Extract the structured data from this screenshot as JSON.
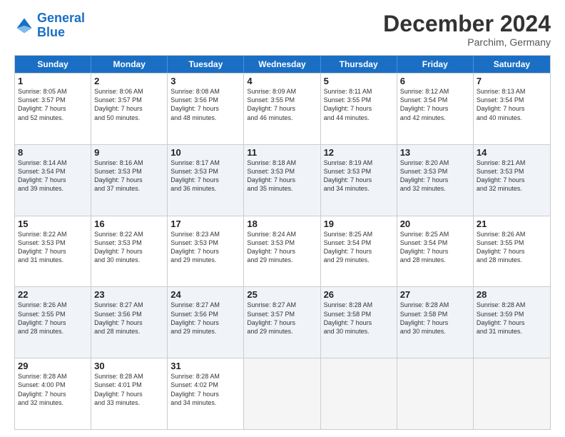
{
  "header": {
    "logo_line1": "General",
    "logo_line2": "Blue",
    "title": "December 2024",
    "subtitle": "Parchim, Germany"
  },
  "calendar": {
    "days_of_week": [
      "Sunday",
      "Monday",
      "Tuesday",
      "Wednesday",
      "Thursday",
      "Friday",
      "Saturday"
    ],
    "weeks": [
      [
        {
          "day": "",
          "empty": true
        },
        {
          "day": "",
          "empty": true
        },
        {
          "day": "",
          "empty": true
        },
        {
          "day": "",
          "empty": true
        },
        {
          "day": "",
          "empty": true
        },
        {
          "day": "",
          "empty": true
        },
        {
          "day": "",
          "empty": true
        }
      ],
      [
        {
          "day": "1",
          "sunrise": "8:05 AM",
          "sunset": "3:57 PM",
          "daylight": "7 hours and 52 minutes."
        },
        {
          "day": "2",
          "sunrise": "8:06 AM",
          "sunset": "3:57 PM",
          "daylight": "7 hours and 50 minutes."
        },
        {
          "day": "3",
          "sunrise": "8:08 AM",
          "sunset": "3:56 PM",
          "daylight": "7 hours and 48 minutes."
        },
        {
          "day": "4",
          "sunrise": "8:09 AM",
          "sunset": "3:55 PM",
          "daylight": "7 hours and 46 minutes."
        },
        {
          "day": "5",
          "sunrise": "8:11 AM",
          "sunset": "3:55 PM",
          "daylight": "7 hours and 44 minutes."
        },
        {
          "day": "6",
          "sunrise": "8:12 AM",
          "sunset": "3:54 PM",
          "daylight": "7 hours and 42 minutes."
        },
        {
          "day": "7",
          "sunrise": "8:13 AM",
          "sunset": "3:54 PM",
          "daylight": "7 hours and 40 minutes."
        }
      ],
      [
        {
          "day": "8",
          "sunrise": "8:14 AM",
          "sunset": "3:54 PM",
          "daylight": "7 hours and 39 minutes."
        },
        {
          "day": "9",
          "sunrise": "8:16 AM",
          "sunset": "3:53 PM",
          "daylight": "7 hours and 37 minutes."
        },
        {
          "day": "10",
          "sunrise": "8:17 AM",
          "sunset": "3:53 PM",
          "daylight": "7 hours and 36 minutes."
        },
        {
          "day": "11",
          "sunrise": "8:18 AM",
          "sunset": "3:53 PM",
          "daylight": "7 hours and 35 minutes."
        },
        {
          "day": "12",
          "sunrise": "8:19 AM",
          "sunset": "3:53 PM",
          "daylight": "7 hours and 34 minutes."
        },
        {
          "day": "13",
          "sunrise": "8:20 AM",
          "sunset": "3:53 PM",
          "daylight": "7 hours and 32 minutes."
        },
        {
          "day": "14",
          "sunrise": "8:21 AM",
          "sunset": "3:53 PM",
          "daylight": "7 hours and 32 minutes."
        }
      ],
      [
        {
          "day": "15",
          "sunrise": "8:22 AM",
          "sunset": "3:53 PM",
          "daylight": "7 hours and 31 minutes."
        },
        {
          "day": "16",
          "sunrise": "8:22 AM",
          "sunset": "3:53 PM",
          "daylight": "7 hours and 30 minutes."
        },
        {
          "day": "17",
          "sunrise": "8:23 AM",
          "sunset": "3:53 PM",
          "daylight": "7 hours and 29 minutes."
        },
        {
          "day": "18",
          "sunrise": "8:24 AM",
          "sunset": "3:53 PM",
          "daylight": "7 hours and 29 minutes."
        },
        {
          "day": "19",
          "sunrise": "8:25 AM",
          "sunset": "3:54 PM",
          "daylight": "7 hours and 29 minutes."
        },
        {
          "day": "20",
          "sunrise": "8:25 AM",
          "sunset": "3:54 PM",
          "daylight": "7 hours and 28 minutes."
        },
        {
          "day": "21",
          "sunrise": "8:26 AM",
          "sunset": "3:55 PM",
          "daylight": "7 hours and 28 minutes."
        }
      ],
      [
        {
          "day": "22",
          "sunrise": "8:26 AM",
          "sunset": "3:55 PM",
          "daylight": "7 hours and 28 minutes."
        },
        {
          "day": "23",
          "sunrise": "8:27 AM",
          "sunset": "3:56 PM",
          "daylight": "7 hours and 28 minutes."
        },
        {
          "day": "24",
          "sunrise": "8:27 AM",
          "sunset": "3:56 PM",
          "daylight": "7 hours and 29 minutes."
        },
        {
          "day": "25",
          "sunrise": "8:27 AM",
          "sunset": "3:57 PM",
          "daylight": "7 hours and 29 minutes."
        },
        {
          "day": "26",
          "sunrise": "8:28 AM",
          "sunset": "3:58 PM",
          "daylight": "7 hours and 30 minutes."
        },
        {
          "day": "27",
          "sunrise": "8:28 AM",
          "sunset": "3:58 PM",
          "daylight": "7 hours and 30 minutes."
        },
        {
          "day": "28",
          "sunrise": "8:28 AM",
          "sunset": "3:59 PM",
          "daylight": "7 hours and 31 minutes."
        }
      ],
      [
        {
          "day": "29",
          "sunrise": "8:28 AM",
          "sunset": "4:00 PM",
          "daylight": "7 hours and 32 minutes."
        },
        {
          "day": "30",
          "sunrise": "8:28 AM",
          "sunset": "4:01 PM",
          "daylight": "7 hours and 33 minutes."
        },
        {
          "day": "31",
          "sunrise": "8:28 AM",
          "sunset": "4:02 PM",
          "daylight": "7 hours and 34 minutes."
        },
        {
          "day": "",
          "empty": true
        },
        {
          "day": "",
          "empty": true
        },
        {
          "day": "",
          "empty": true
        },
        {
          "day": "",
          "empty": true
        }
      ]
    ]
  }
}
